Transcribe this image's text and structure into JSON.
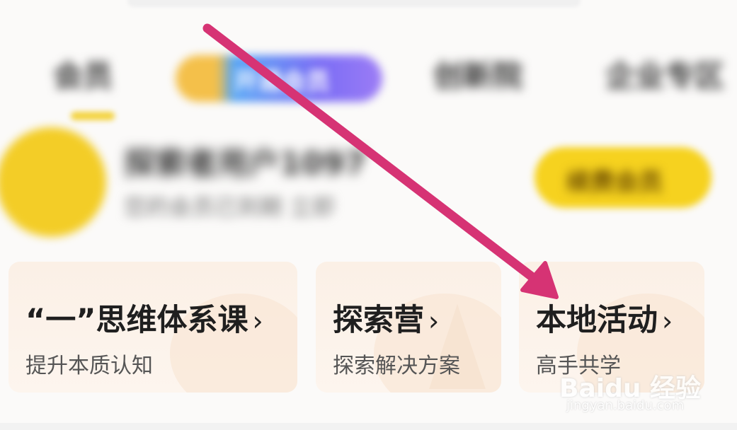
{
  "tabs": {
    "items": [
      {
        "label": "会员"
      },
      {
        "label": "开通会员"
      },
      {
        "label": "创新院"
      },
      {
        "label": "企业专区"
      }
    ]
  },
  "profile": {
    "name": "探索者用户1097",
    "subtitle": "您的会员已到期 立即",
    "member_button_label": "续费会员"
  },
  "cards": [
    {
      "title": "“一”思维体系课",
      "subtitle": "提升本质认知"
    },
    {
      "title": "探索营",
      "subtitle": "探索解决方案"
    },
    {
      "title": "本地活动",
      "subtitle": "高手共学"
    }
  ],
  "chevron": "›",
  "annotation": {
    "color": "#d63374",
    "icon": "arrow-icon"
  },
  "watermark": {
    "logo_text": "Baidu 经验",
    "url": "jingyan.baidu.com"
  },
  "colors": {
    "accent_yellow": "#f3cd27",
    "card_bg": "#fbf0e6"
  }
}
